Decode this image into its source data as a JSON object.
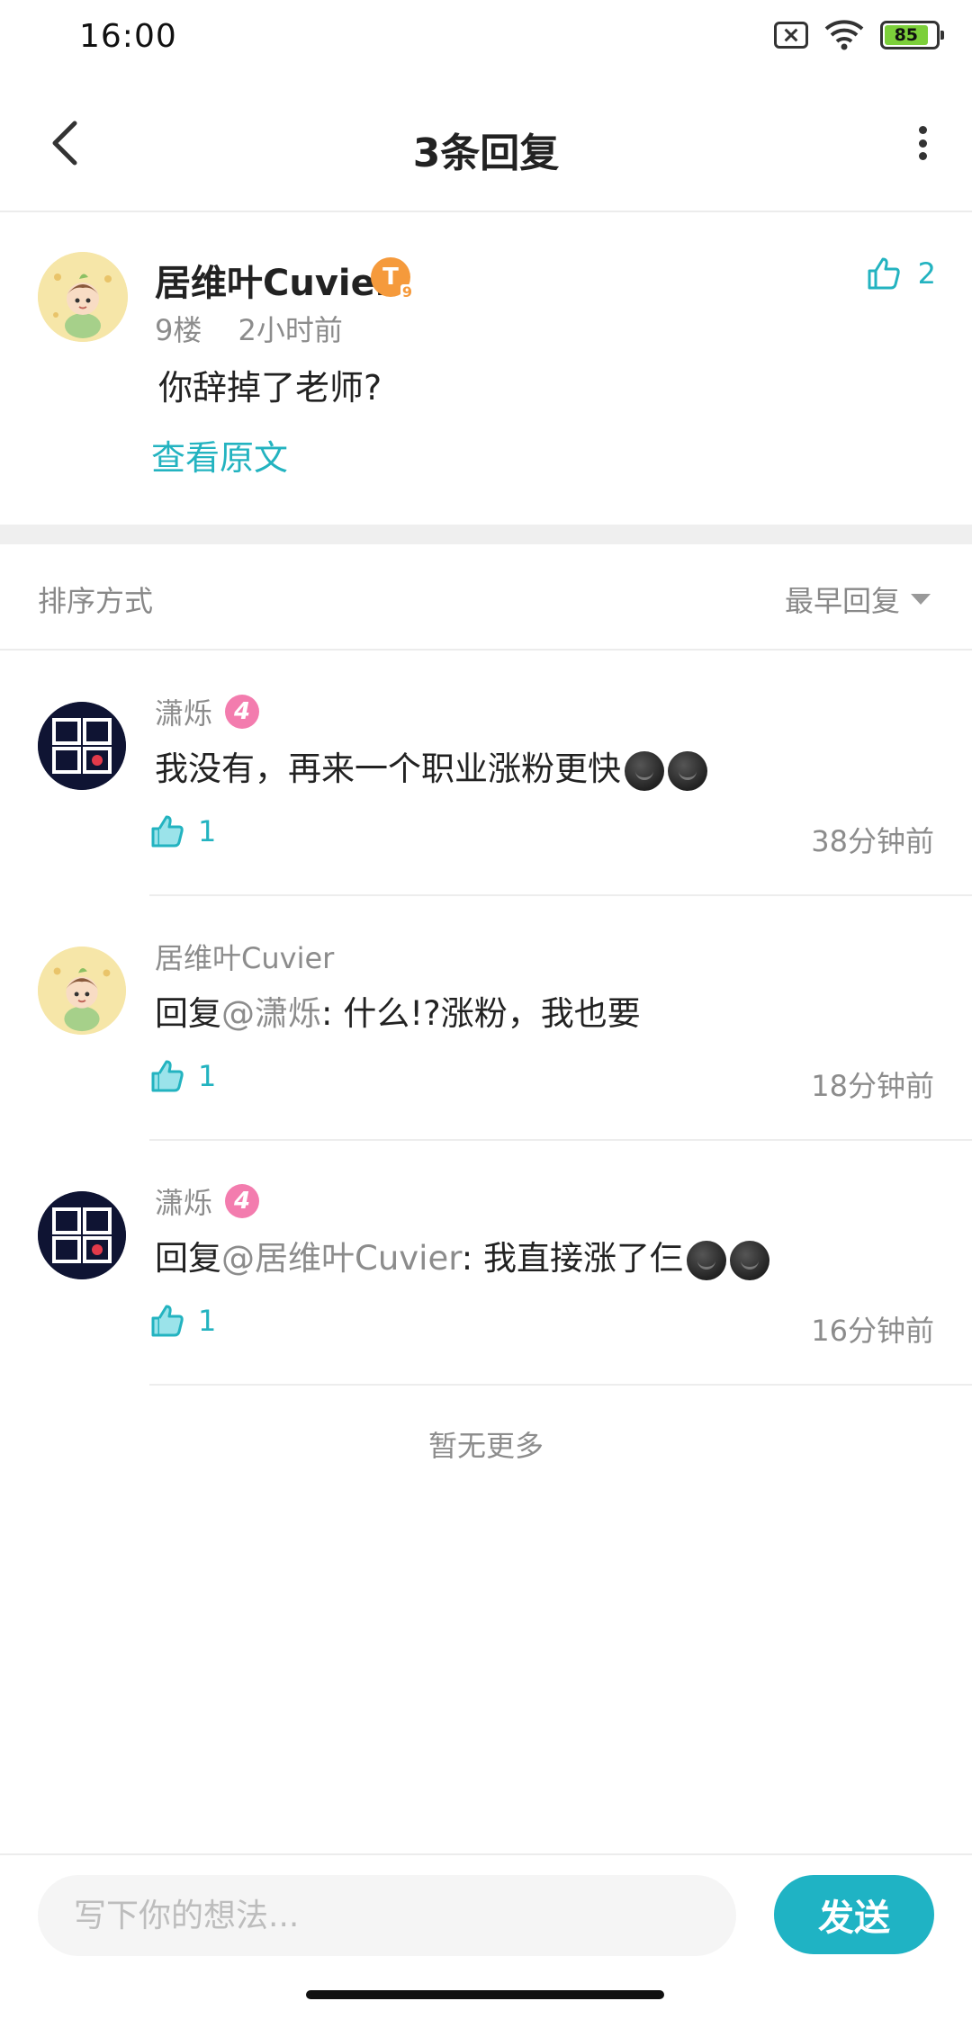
{
  "status_bar": {
    "time": "16:00",
    "battery": "85"
  },
  "header": {
    "title": "3条回复"
  },
  "main_post": {
    "author": "居维叶Cuvier",
    "badge": "T",
    "badge_level": "9",
    "floor": "9楼",
    "time": "2小时前",
    "content": "你辞掉了老师?",
    "view_original": "查看原文",
    "likes": "2"
  },
  "sort": {
    "label": "排序方式",
    "value": "最早回复"
  },
  "replies": [
    {
      "author": "潇烁",
      "level": "4",
      "prefix": "",
      "mention": "",
      "text": "我没有，再来一个职业涨粉更快",
      "emoji_count": 2,
      "likes": "1",
      "time": "38分钟前"
    },
    {
      "author": "居维叶Cuvier",
      "level": "",
      "prefix": "回复",
      "mention": "@潇烁",
      "text": ": 什么!?涨粉，我也要",
      "emoji_count": 0,
      "likes": "1",
      "time": "18分钟前"
    },
    {
      "author": "潇烁",
      "level": "4",
      "prefix": "回复",
      "mention": "@居维叶Cuvier",
      "text": ": 我直接涨了仨",
      "emoji_count": 2,
      "likes": "1",
      "time": "16分钟前"
    }
  ],
  "footer_note": "暂无更多",
  "input": {
    "placeholder": "写下你的想法...",
    "send_label": "发送"
  },
  "colors": {
    "accent": "#1fb3c4",
    "level_badge": "#f37cae",
    "t_badge": "#f59a3c"
  },
  "icons": [
    "back-arrow-icon",
    "more-vertical-icon",
    "thumbs-up-icon",
    "chevron-down-icon",
    "sim-off-icon",
    "wifi-icon",
    "battery-icon"
  ]
}
